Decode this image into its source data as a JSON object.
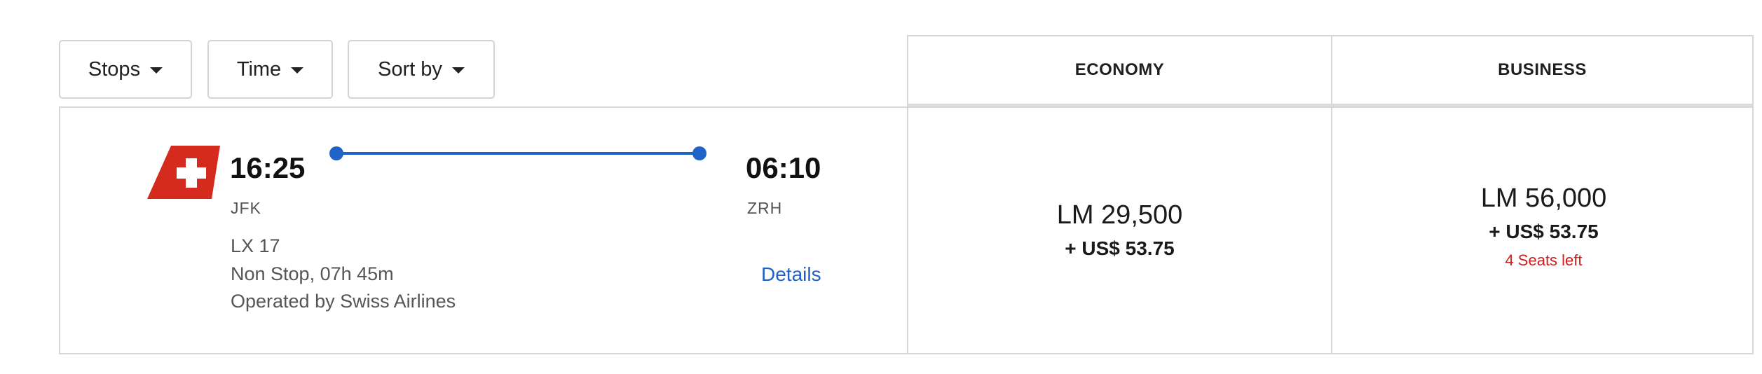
{
  "filters": {
    "stops_label": "Stops",
    "time_label": "Time",
    "sort_label": "Sort by"
  },
  "cabins": {
    "economy_label": "ECONOMY",
    "business_label": "BUSINESS"
  },
  "flight": {
    "departure_time": "16:25",
    "arrival_time": "06:10",
    "departure_airport": "JFK",
    "arrival_airport": "ZRH",
    "flight_number": "LX 17",
    "duration": "Non Stop, 07h 45m",
    "operator": "Operated by Swiss Airlines",
    "details_label": "Details",
    "airline_logo": "swiss-airlines-logo",
    "route_color": "#1f63c6"
  },
  "prices": {
    "economy": {
      "miles": "LM 29,500",
      "fee": "+ US$ 53.75"
    },
    "business": {
      "miles": "LM 56,000",
      "fee": "+ US$ 53.75",
      "seats_left": "4 Seats left",
      "seats_color": "#cc1f1f"
    }
  }
}
